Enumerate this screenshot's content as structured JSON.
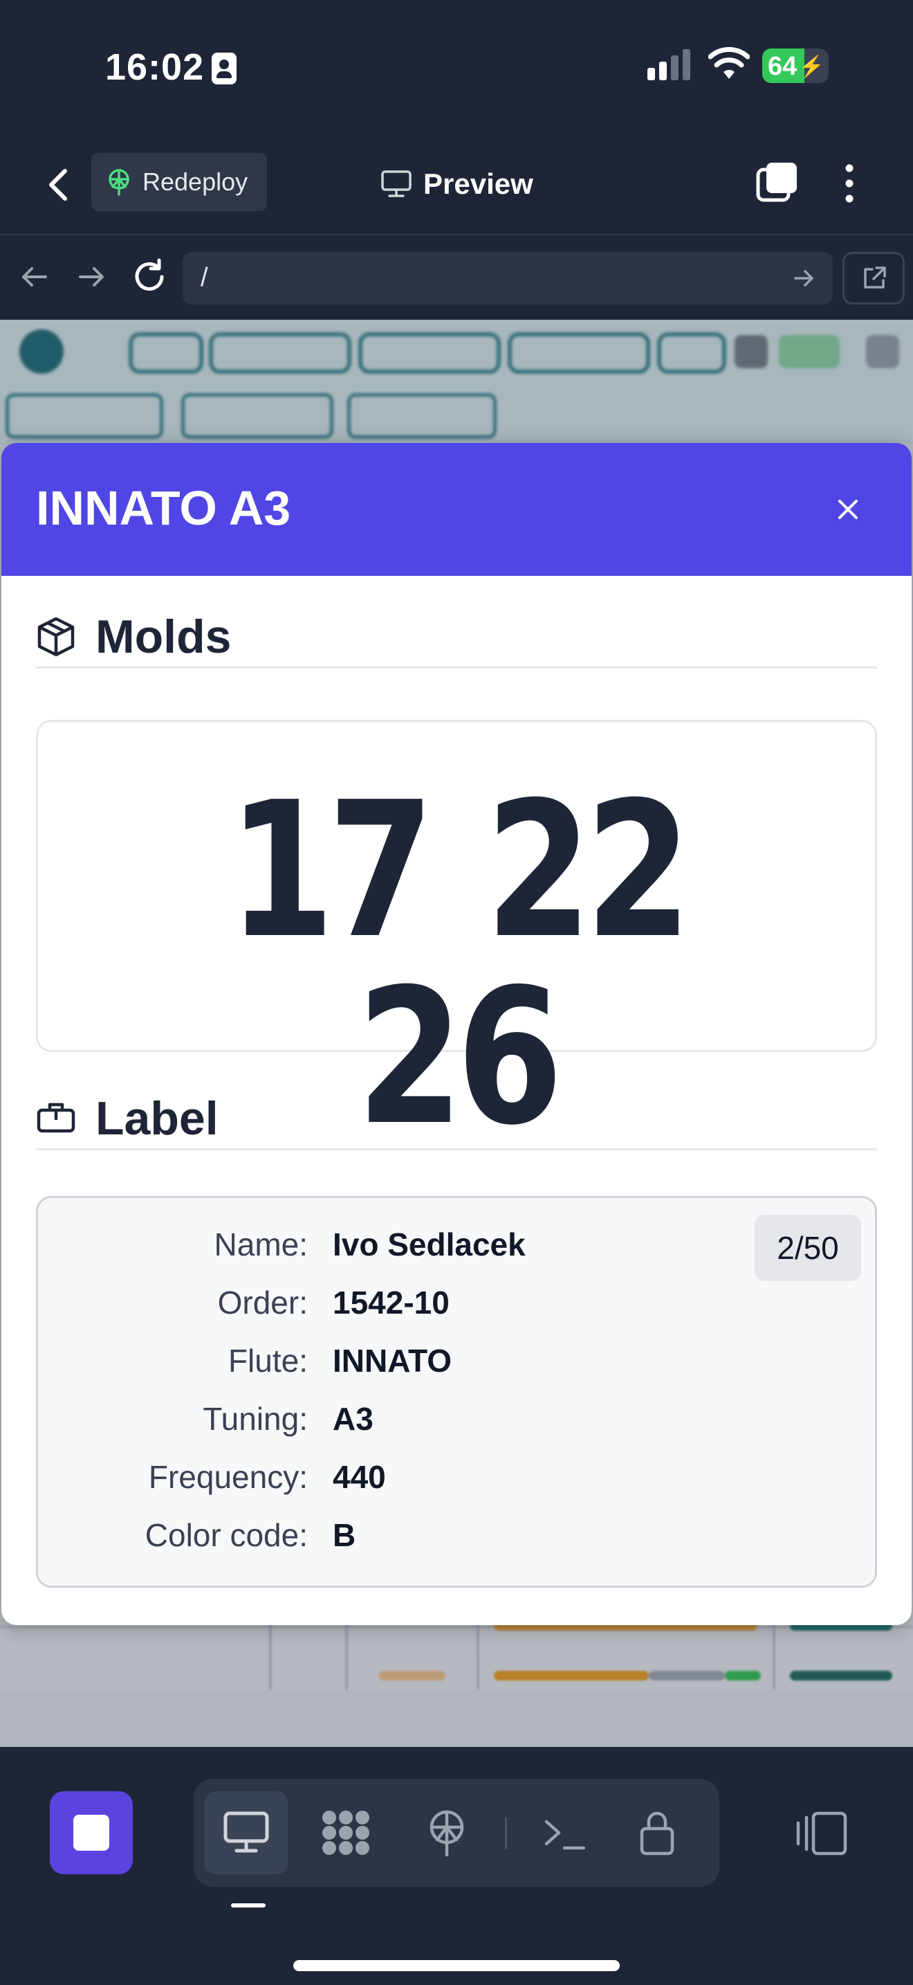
{
  "status_bar": {
    "time": "16:02",
    "battery_level": "64",
    "battery_percent": 64,
    "icons": [
      "id-card-icon",
      "signal-icon",
      "wifi-icon",
      "battery-charging-icon"
    ]
  },
  "app_bar": {
    "redeploy_label": "Redeploy",
    "preview_label": "Preview",
    "icons": [
      "back-icon",
      "redeploy-icon",
      "monitor-icon",
      "tabs-icon",
      "more-icon"
    ]
  },
  "nav_bar": {
    "url": "/",
    "icons": [
      "back-arrow-icon",
      "forward-arrow-icon",
      "reload-icon",
      "go-icon",
      "external-link-icon"
    ]
  },
  "modal": {
    "title": "INNATO A3",
    "close_icon": "close-icon",
    "molds": {
      "heading": "Molds",
      "icon": "cube-icon",
      "numbers": "17 22 26"
    },
    "label": {
      "heading": "Label",
      "icon": "label-icon",
      "count": "2/50",
      "rows": [
        {
          "key": "Name:",
          "value": "Ivo Sedlacek"
        },
        {
          "key": "Order:",
          "value": "1542-10"
        },
        {
          "key": "Flute:",
          "value": "INNATO"
        },
        {
          "key": "Tuning:",
          "value": "A3"
        },
        {
          "key": "Frequency:",
          "value": "440"
        },
        {
          "key": "Color code:",
          "value": "B"
        }
      ]
    }
  },
  "dock": {
    "icons": [
      "stop-icon",
      "monitor-icon",
      "grid-icon",
      "deploy-icon",
      "terminal-icon",
      "lock-icon",
      "panel-toggle-icon"
    ]
  },
  "colors": {
    "accent": "#4f46e5",
    "dark_bg": "#1e2536",
    "stop_button": "#5b43e0"
  }
}
